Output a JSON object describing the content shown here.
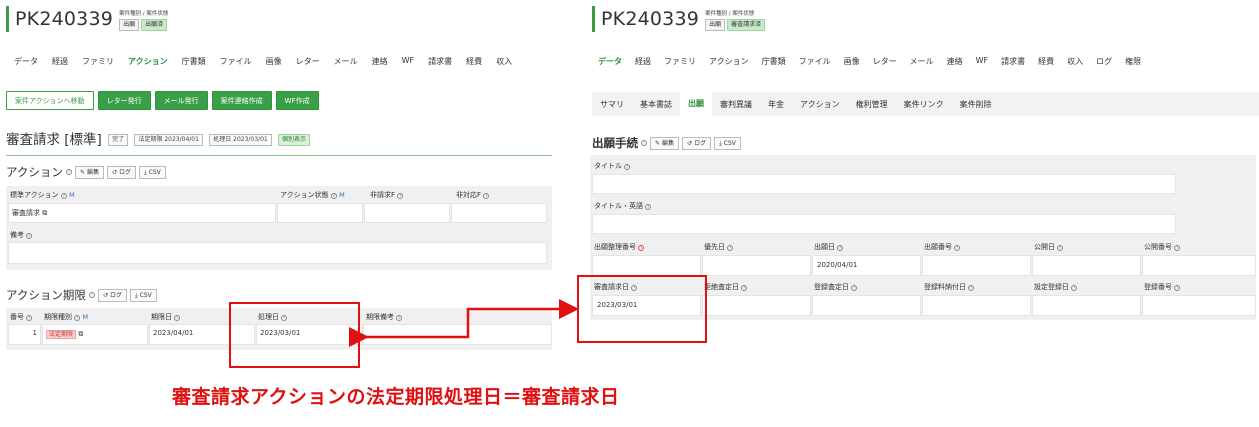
{
  "left": {
    "case_id": "PK240339",
    "meta_label": "案件種別 / 案件状態",
    "badges": [
      "出願",
      "出願済"
    ],
    "tabs": [
      "データ",
      "経過",
      "ファミリ",
      "アクション",
      "庁書類",
      "ファイル",
      "画像",
      "レター",
      "メール",
      "連絡",
      "WF",
      "請求書",
      "経費",
      "収入"
    ],
    "active_tab": "アクション",
    "buttons": [
      "案件アクションへ移動",
      "レター発行",
      "メール発行",
      "案件連絡作成",
      "WF作成"
    ],
    "page_title": "審査請求 [標準]",
    "title_chips": [
      "完了",
      "法定期限 2023/04/01",
      "処理日 2023/03/01",
      "個別表示"
    ],
    "action_section": {
      "title": "アクション",
      "edit": "編集",
      "log": "ログ",
      "csv": "CSV",
      "headers": [
        "標準アクション",
        "アクション状態",
        "非請求F",
        "非対応F"
      ],
      "m_mark": "M",
      "row": [
        "審査請求",
        "",
        "",
        ""
      ],
      "remarks_label": "備考"
    },
    "deadline_section": {
      "title": "アクション期限",
      "log": "ログ",
      "csv": "CSV",
      "headers": [
        "番号",
        "期限種別",
        "期限日",
        "処理日",
        "期限備考"
      ],
      "m_mark": "M",
      "row": {
        "no": "1",
        "type": "法定期限",
        "deadline": "2023/04/01",
        "processed": "2023/03/01",
        "note": ""
      }
    }
  },
  "right": {
    "case_id": "PK240339",
    "meta_label": "案件種別 / 案件状態",
    "badges": [
      "出願",
      "審査請求済"
    ],
    "tabs": [
      "データ",
      "経過",
      "ファミリ",
      "アクション",
      "庁書類",
      "ファイル",
      "画像",
      "レター",
      "メール",
      "連絡",
      "WF",
      "請求書",
      "経費",
      "収入",
      "ログ",
      "権限"
    ],
    "active_tab": "データ",
    "subtabs": [
      "サマリ",
      "基本書誌",
      "出願",
      "審判異議",
      "年金",
      "アクション",
      "権利管理",
      "案件リンク",
      "案件削除"
    ],
    "active_subtab": "出願",
    "section_title": "出願手続",
    "edit": "編集",
    "log": "ログ",
    "csv": "CSV",
    "title_label": "タイトル",
    "title_en_label": "タイトル・英語",
    "row1_headers": [
      "出願整理番号",
      "優先日",
      "出願日",
      "出願番号",
      "公開日",
      "公開番号"
    ],
    "row1_values": [
      "",
      "",
      "2020/04/01",
      "",
      "",
      ""
    ],
    "row2_headers": [
      "審査請求日",
      "拒絶査定日",
      "登録査定日",
      "登録料納付日",
      "設定登録日",
      "登録番号"
    ],
    "row2_values": [
      "2023/03/01",
      "",
      "",
      "",
      "",
      ""
    ]
  },
  "annotation": {
    "caption": "審査請求アクションの法定期限処理日＝審査請求日",
    "color": "#e01010"
  },
  "colors": {
    "accent": "#3aa048",
    "active_text": "#2e8b3a",
    "badge_green": "#c8ecc8"
  }
}
